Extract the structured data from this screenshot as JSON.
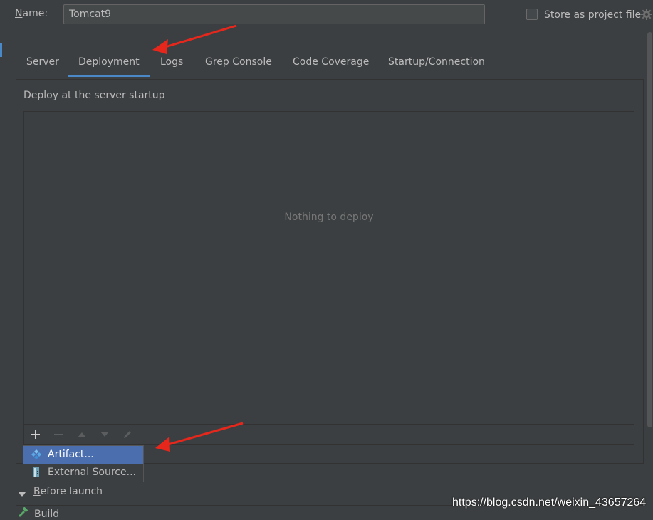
{
  "header": {
    "name_label": "Name:",
    "name_value": "Tomcat9",
    "store_label": "Store as project file",
    "store_checked": false
  },
  "tabs": [
    {
      "label": "Server",
      "active": false
    },
    {
      "label": "Deployment",
      "active": true
    },
    {
      "label": "Logs",
      "active": false
    },
    {
      "label": "Grep Console",
      "active": false
    },
    {
      "label": "Code Coverage",
      "active": false
    },
    {
      "label": "Startup/Connection",
      "active": false
    }
  ],
  "deploy_section": {
    "title": "Deploy at the server startup",
    "empty_text": "Nothing to deploy"
  },
  "toolbar": {
    "icons": [
      "add-icon",
      "remove-icon",
      "move-up-icon",
      "move-down-icon",
      "edit-icon"
    ]
  },
  "popup_menu": {
    "items": [
      {
        "label": "Artifact...",
        "icon": "artifact-icon",
        "selected": true
      },
      {
        "label": "External Source...",
        "icon": "external-source-icon",
        "selected": false
      }
    ]
  },
  "before_launch": {
    "title": "Before launch",
    "first_task": "Build"
  },
  "watermark": "https://blog.csdn.net/weixin_43657264",
  "colors": {
    "background": "#3c3f41",
    "accent": "#4a88c7",
    "selection": "#4b6eaf",
    "arrow": "#e8271c"
  }
}
